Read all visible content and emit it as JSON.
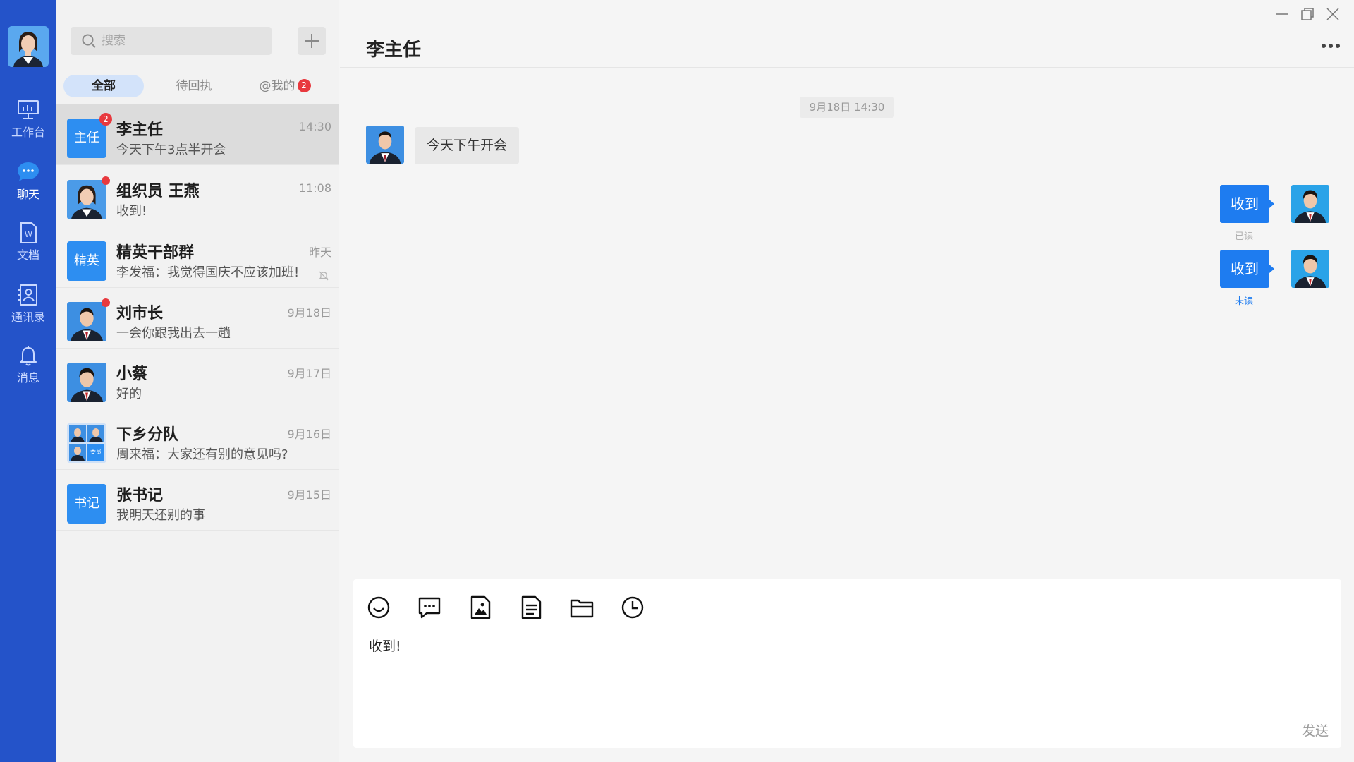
{
  "rail": {
    "items": [
      {
        "label": "工作台",
        "icon": "monitor-icon"
      },
      {
        "label": "聊天",
        "icon": "chat-icon"
      },
      {
        "label": "文档",
        "icon": "document-icon"
      },
      {
        "label": "通讯录",
        "icon": "contacts-icon"
      },
      {
        "label": "消息",
        "icon": "bell-icon"
      }
    ],
    "active": "聊天",
    "color": "#2453c9"
  },
  "list": {
    "search_placeholder": "搜索",
    "filters": [
      {
        "label": "全部"
      },
      {
        "label": "待回执"
      },
      {
        "label": "@我的",
        "badge": "2"
      }
    ],
    "conversations": [
      {
        "name": "李主任",
        "preview": "今天下午3点半开会",
        "time": "14:30",
        "avatar_text": "主任",
        "unread": "2"
      },
      {
        "name": "组织员 王燕",
        "preview": "收到!",
        "time": "11:08"
      },
      {
        "name": "精英干部群",
        "preview": "李发福：我觉得国庆不应该加班!",
        "time": "昨天",
        "avatar_text": "精英"
      },
      {
        "name": "刘市长",
        "preview": "一会你跟我出去一趟",
        "time": "9月18日"
      },
      {
        "name": "小蔡",
        "preview": "好的",
        "time": "9月17日"
      },
      {
        "name": "下乡分队",
        "preview": "周来福：大家还有别的意见吗?",
        "time": "9月16日",
        "group_tag": "委员"
      },
      {
        "name": "张书记",
        "preview": "我明天还别的事",
        "time": "9月15日",
        "avatar_text": "书记"
      }
    ]
  },
  "chat": {
    "title": "李主任",
    "timestamp": "9月18日  14:30",
    "messages": [
      {
        "text": "今天下午开会"
      },
      {
        "text": "收到",
        "receipt": "已读"
      },
      {
        "text": "收到",
        "receipt": "未读"
      }
    ],
    "accent": "#1e7cf0"
  },
  "composer": {
    "draft": "收到!",
    "send_label": "发送"
  }
}
